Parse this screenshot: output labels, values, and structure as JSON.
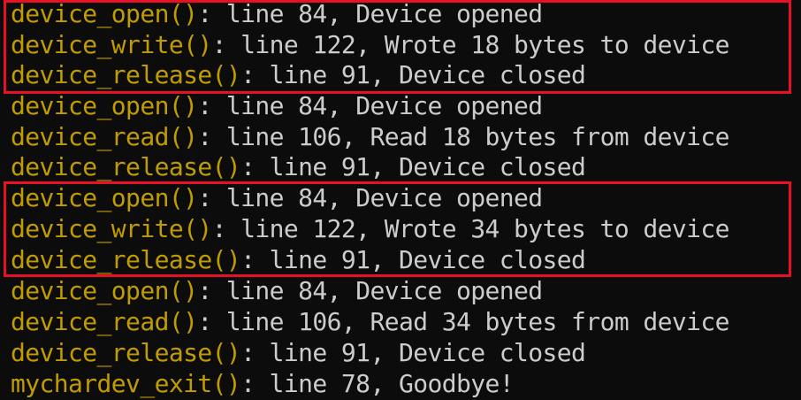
{
  "colors": {
    "background": "#0c0c0c",
    "function_name": "#c19c00",
    "message_text": "#cccccc",
    "highlight_border": "#e81123"
  },
  "log_lines": [
    {
      "fn": "device_open()",
      "msg": ": line 84, Device opened"
    },
    {
      "fn": "device_write()",
      "msg": ": line 122, Wrote 18 bytes to device"
    },
    {
      "fn": "device_release()",
      "msg": ": line 91, Device closed"
    },
    {
      "fn": "device_open()",
      "msg": ": line 84, Device opened"
    },
    {
      "fn": "device_read()",
      "msg": ": line 106, Read 18 bytes from device"
    },
    {
      "fn": "device_release()",
      "msg": ": line 91, Device closed"
    },
    {
      "fn": "device_open()",
      "msg": ": line 84, Device opened"
    },
    {
      "fn": "device_write()",
      "msg": ": line 122, Wrote 34 bytes to device"
    },
    {
      "fn": "device_release()",
      "msg": ": line 91, Device closed"
    },
    {
      "fn": "device_open()",
      "msg": ": line 84, Device opened"
    },
    {
      "fn": "device_read()",
      "msg": ": line 106, Read 34 bytes from device"
    },
    {
      "fn": "device_release()",
      "msg": ": line 91, Device closed"
    },
    {
      "fn": "mychardev_exit()",
      "msg": ": line 78, Goodbye!"
    }
  ]
}
